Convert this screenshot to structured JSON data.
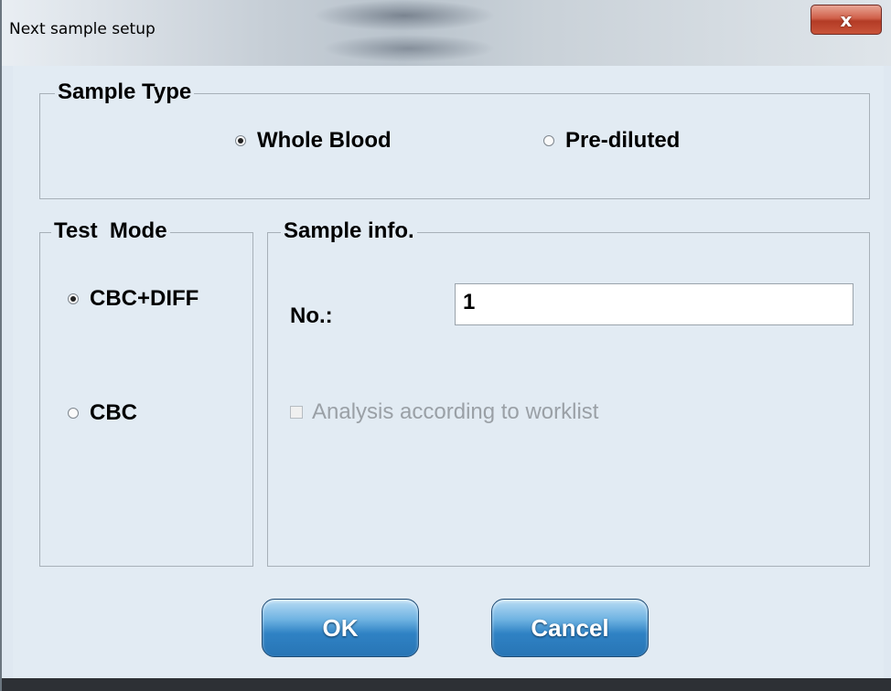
{
  "window": {
    "title": "Next sample setup",
    "close_label": "x"
  },
  "sample_type": {
    "legend": "Sample Type",
    "options": [
      {
        "label": "Whole Blood",
        "selected": true
      },
      {
        "label": "Pre-diluted",
        "selected": false
      }
    ]
  },
  "test_mode": {
    "legend": "Test  Mode",
    "options": [
      {
        "label": "CBC+DIFF",
        "selected": true
      },
      {
        "label": "CBC",
        "selected": false
      }
    ]
  },
  "sample_info": {
    "legend": "Sample info.",
    "number_label": "No.:",
    "number_value": "1",
    "worklist_label": "Analysis according to worklist",
    "worklist_checked": false,
    "worklist_enabled": false
  },
  "buttons": {
    "ok_label": "OK",
    "cancel_label": "Cancel"
  },
  "colors": {
    "accent": "#2f82c4",
    "close": "#c9543a"
  }
}
